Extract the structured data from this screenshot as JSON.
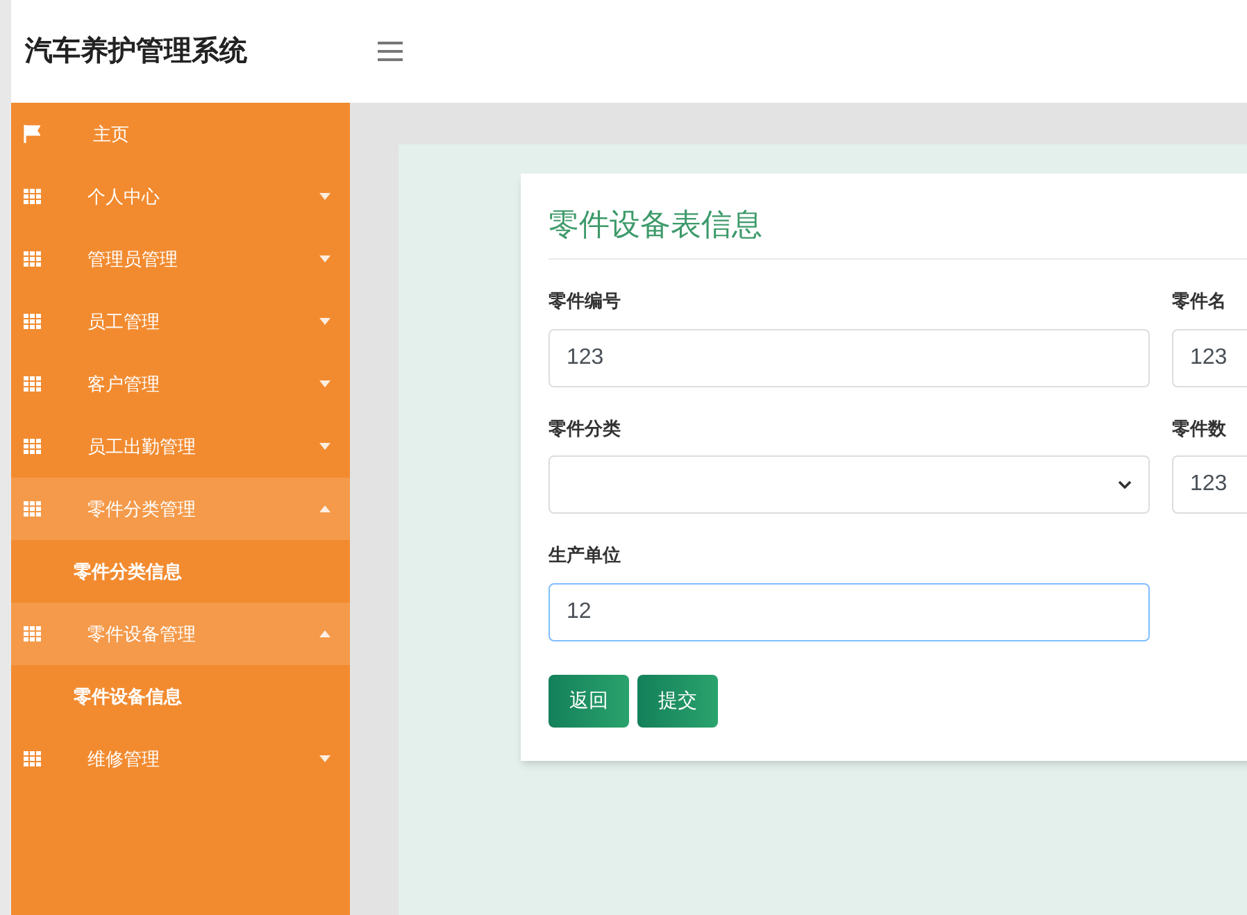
{
  "header": {
    "title": "汽车养护管理系统"
  },
  "sidebar": {
    "items": [
      {
        "label": "主页",
        "kind": "home",
        "expanded": false
      },
      {
        "label": "个人中心",
        "kind": "section",
        "expanded": false
      },
      {
        "label": "管理员管理",
        "kind": "section",
        "expanded": false
      },
      {
        "label": "员工管理",
        "kind": "section",
        "expanded": false
      },
      {
        "label": "客户管理",
        "kind": "section",
        "expanded": false
      },
      {
        "label": "员工出勤管理",
        "kind": "section",
        "expanded": false
      },
      {
        "label": "零件分类管理",
        "kind": "section",
        "expanded": true,
        "children": [
          {
            "label": "零件分类信息"
          }
        ]
      },
      {
        "label": "零件设备管理",
        "kind": "section",
        "expanded": true,
        "children": [
          {
            "label": "零件设备信息"
          }
        ]
      },
      {
        "label": "维修管理",
        "kind": "section",
        "expanded": false
      }
    ]
  },
  "form": {
    "title": "零件设备表信息",
    "rows": [
      [
        {
          "label": "零件编号",
          "kind": "text",
          "value": "123",
          "focused": false
        },
        {
          "label": "零件名",
          "kind": "text",
          "value": "123",
          "focused": false
        }
      ],
      [
        {
          "label": "零件分类",
          "kind": "select"
        },
        {
          "label": "零件数",
          "kind": "text",
          "value": "123",
          "focused": false
        }
      ],
      [
        {
          "label": "生产单位",
          "kind": "text",
          "value": "12",
          "focused": true
        }
      ]
    ],
    "buttons": [
      "返回",
      "提交"
    ]
  }
}
